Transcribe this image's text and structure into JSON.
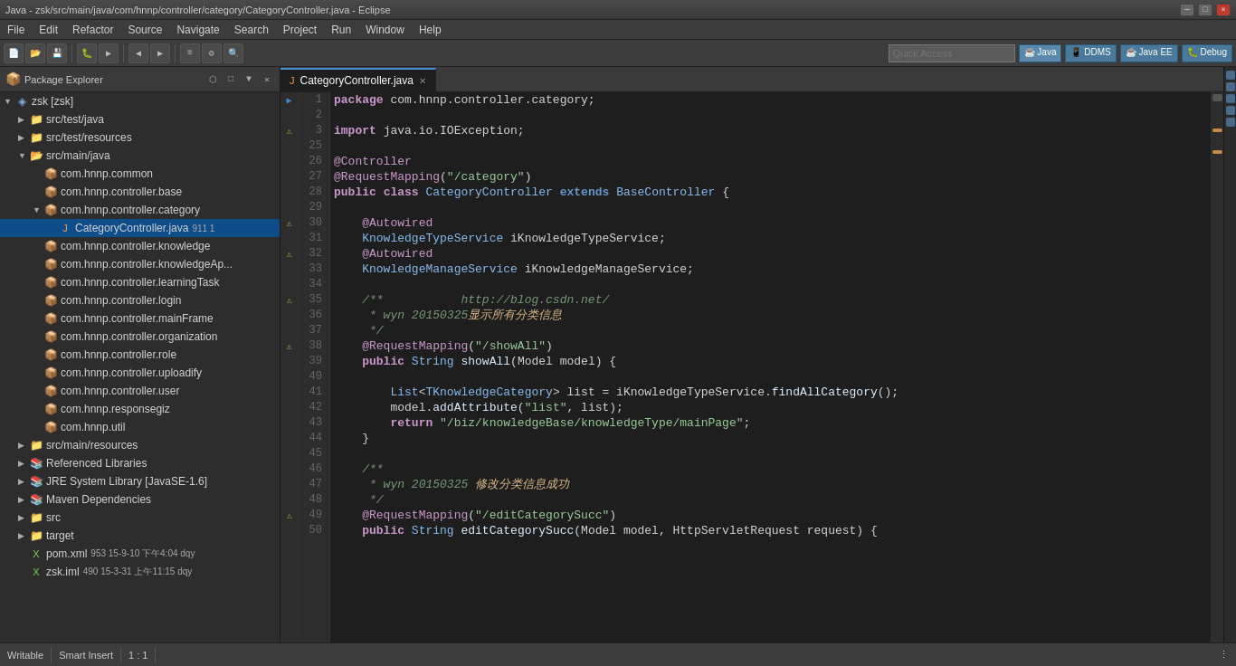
{
  "window": {
    "title": "Java - zsk/src/main/java/com/hnnp/controller/category/CategoryController.java - Eclipse"
  },
  "menu": {
    "items": [
      "File",
      "Edit",
      "Refactor",
      "Source",
      "Navigate",
      "Search",
      "Project",
      "Run",
      "Window",
      "Help"
    ]
  },
  "quick_access": {
    "placeholder": "Quick Access",
    "label": "Quick Access"
  },
  "perspectives": [
    {
      "label": "Java",
      "active": true
    },
    {
      "label": "DDMS"
    },
    {
      "label": "Java EE"
    },
    {
      "label": "Debug"
    }
  ],
  "package_explorer": {
    "title": "Package Explorer",
    "tree": [
      {
        "level": 0,
        "type": "project",
        "label": "zsk [zsk]",
        "expanded": true
      },
      {
        "level": 1,
        "type": "folder",
        "label": "src/test/java",
        "expanded": false
      },
      {
        "level": 1,
        "type": "folder",
        "label": "src/test/resources",
        "expanded": false
      },
      {
        "level": 1,
        "type": "folder",
        "label": "src/main/java",
        "expanded": true
      },
      {
        "level": 2,
        "type": "package",
        "label": "com.hnnp.common",
        "expanded": false
      },
      {
        "level": 2,
        "type": "package",
        "label": "com.hnnp.controller.base",
        "expanded": false
      },
      {
        "level": 2,
        "type": "package",
        "label": "com.hnnp.controller.category",
        "expanded": true
      },
      {
        "level": 3,
        "type": "java",
        "label": "CategoryController.java",
        "badge": "911  1",
        "selected": true
      },
      {
        "level": 2,
        "type": "package",
        "label": "com.hnnp.controller.knowledge",
        "expanded": false
      },
      {
        "level": 2,
        "type": "package",
        "label": "com.hnnp.controller.knowledgeAp...",
        "expanded": false
      },
      {
        "level": 2,
        "type": "package",
        "label": "com.hnnp.controller.learningTask",
        "expanded": false
      },
      {
        "level": 2,
        "type": "package",
        "label": "com.hnnp.controller.login",
        "expanded": false
      },
      {
        "level": 2,
        "type": "package",
        "label": "com.hnnp.controller.mainFrame",
        "expanded": false
      },
      {
        "level": 2,
        "type": "package",
        "label": "com.hnnp.controller.organization",
        "expanded": false
      },
      {
        "level": 2,
        "type": "package",
        "label": "com.hnnp.controller.role",
        "expanded": false
      },
      {
        "level": 2,
        "type": "package",
        "label": "com.hnnp.controller.uploadify",
        "expanded": false
      },
      {
        "level": 2,
        "type": "package",
        "label": "com.hnnp.controller.user",
        "expanded": false
      },
      {
        "level": 2,
        "type": "package",
        "label": "com.hnnp.responsegiz",
        "expanded": false
      },
      {
        "level": 2,
        "type": "package",
        "label": "com.hnnp.util",
        "expanded": false
      },
      {
        "level": 1,
        "type": "folder",
        "label": "src/main/resources",
        "expanded": false
      },
      {
        "level": 1,
        "type": "ref-lib",
        "label": "Referenced Libraries",
        "expanded": false
      },
      {
        "level": 1,
        "type": "ref-lib",
        "label": "JRE System Library [JavaSE-1.6]",
        "expanded": false
      },
      {
        "level": 1,
        "type": "ref-lib",
        "label": "Maven Dependencies",
        "expanded": false
      },
      {
        "level": 1,
        "type": "folder",
        "label": "src",
        "expanded": false
      },
      {
        "level": 1,
        "type": "folder",
        "label": "target",
        "expanded": false
      },
      {
        "level": 1,
        "type": "xml",
        "label": "pom.xml",
        "badge": "953  15-9-10 下午4:04  dqy"
      },
      {
        "level": 1,
        "type": "xml",
        "label": "zsk.iml",
        "badge": "490  15-3-31 上午11:15  dqy"
      }
    ]
  },
  "editor": {
    "tab_label": "CategoryController.java",
    "file_icon": "java-icon"
  },
  "code": {
    "lines": [
      {
        "num": 1,
        "marker": "bookmark",
        "html": "<span class='kw'>package</span> <span class='plain'>com.hnnp.controller.category;</span>"
      },
      {
        "num": 2,
        "marker": "",
        "html": ""
      },
      {
        "num": 3,
        "marker": "warn",
        "html": "<span class='kw'>import</span> <span class='plain'>java.io.IOException;</span>"
      },
      {
        "num": 25,
        "marker": "",
        "html": ""
      },
      {
        "num": 26,
        "marker": "",
        "html": "<span class='ann'>@Controller</span>"
      },
      {
        "num": 27,
        "marker": "",
        "html": "<span class='ann'>@RequestMapping</span><span class='plain'>(</span><span class='str'>\"/category\"</span><span class='plain'>)</span>"
      },
      {
        "num": 28,
        "marker": "",
        "html": "<span class='kw'>public</span> <span class='kw'>class</span> <span class='cls'>CategoryController</span> <span class='kw2'>extends</span> <span class='cls'>BaseController</span> <span class='plain'>{</span>"
      },
      {
        "num": 29,
        "marker": "",
        "html": ""
      },
      {
        "num": 30,
        "marker": "warn",
        "html": "    <span class='ann'>@Autowired</span>"
      },
      {
        "num": 31,
        "marker": "",
        "html": "    <span class='cls'>KnowledgeTypeService</span> <span class='plain'>iKnowledgeTypeService;</span>"
      },
      {
        "num": 32,
        "marker": "warn",
        "html": "    <span class='ann'>@Autowired</span>"
      },
      {
        "num": 33,
        "marker": "",
        "html": "    <span class='cls'>KnowledgeManageService</span> <span class='plain'>iKnowledgeManageService;</span>"
      },
      {
        "num": 34,
        "marker": "",
        "html": ""
      },
      {
        "num": 35,
        "marker": "warn",
        "html": "    <span class='cmt'>/**           <span class='url'>http://blog.csdn.net/</span></span>"
      },
      {
        "num": 36,
        "marker": "",
        "html": "    <span class='cmt'> * wyn 20150325<span class='cn'>显示所有分类信息</span></span>"
      },
      {
        "num": 37,
        "marker": "",
        "html": "    <span class='cmt'> */</span>"
      },
      {
        "num": 38,
        "marker": "warn",
        "html": "    <span class='ann'>@RequestMapping</span><span class='plain'>(</span><span class='str'>\"/showAll\"</span><span class='plain'>)</span>"
      },
      {
        "num": 39,
        "marker": "",
        "html": "    <span class='kw'>public</span> <span class='cls'>String</span> <span class='method'>showAll</span><span class='plain'>(Model model) {</span>"
      },
      {
        "num": 40,
        "marker": "",
        "html": ""
      },
      {
        "num": 41,
        "marker": "",
        "html": "        <span class='cls'>List</span><span class='plain'>&lt;</span><span class='cls'>TKnowledgeCategory</span><span class='plain'>&gt; list = iKnowledgeTypeService.</span><span class='method'>findAllCategory</span><span class='plain'>();</span>"
      },
      {
        "num": 42,
        "marker": "",
        "html": "        <span class='plain'>model.</span><span class='method'>addAttribute</span><span class='plain'>(</span><span class='str'>\"list\"</span><span class='plain'>, list);</span>"
      },
      {
        "num": 43,
        "marker": "",
        "html": "        <span class='kw'>return</span> <span class='str'>\"/biz/knowledgeBase/knowledgeType/mainPage\"</span><span class='plain'>;</span>"
      },
      {
        "num": 44,
        "marker": "",
        "html": "    <span class='plain'>}</span>"
      },
      {
        "num": 45,
        "marker": "",
        "html": ""
      },
      {
        "num": 46,
        "marker": "",
        "html": "    <span class='cmt'>/**</span>"
      },
      {
        "num": 47,
        "marker": "",
        "html": "    <span class='cmt'> * wyn 20150325 <span class='cn'>修改分类信息成功</span></span>"
      },
      {
        "num": 48,
        "marker": "",
        "html": "    <span class='cmt'> */</span>"
      },
      {
        "num": 49,
        "marker": "warn",
        "html": "    <span class='ann'>@RequestMapping</span><span class='plain'>(</span><span class='str'>\"/editCategorySucc\"</span><span class='plain'>)</span>"
      },
      {
        "num": 50,
        "marker": "",
        "html": "    <span class='kw'>public</span> <span class='cls'>String</span> <span class='method'>editCategorySucc</span><span class='plain'>(Model model, HttpServletRequest request) {</span>"
      }
    ]
  },
  "status_bar": {
    "writeable": "Writable",
    "insert_mode": "Smart Insert",
    "position": "1 : 1"
  }
}
